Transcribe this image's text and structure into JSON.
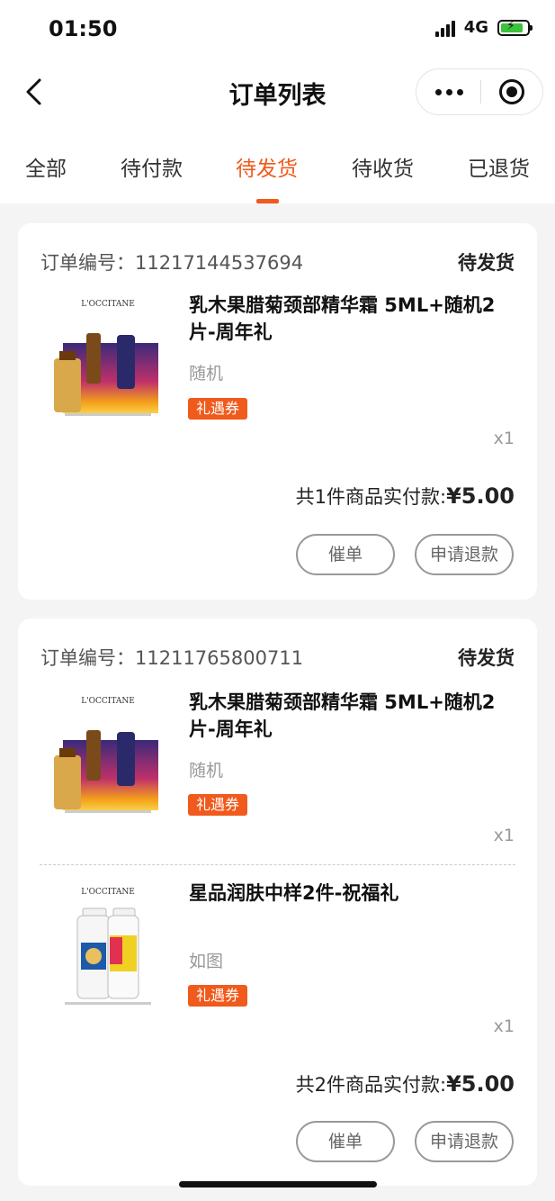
{
  "status_bar": {
    "time": "01:50",
    "network": "4G"
  },
  "nav": {
    "title": "订单列表",
    "more_icon": "more-dots-icon",
    "close_icon": "target-close-icon"
  },
  "tabs": [
    {
      "label": "全部"
    },
    {
      "label": "待付款"
    },
    {
      "label": "待发货",
      "active": true
    },
    {
      "label": "待收货"
    },
    {
      "label": "已退货"
    }
  ],
  "accent_color": "#f05a1c",
  "orders": [
    {
      "order_label": "订单编号：",
      "order_no": "11217144537694",
      "status": "待发货",
      "items": [
        {
          "name": "乳木果腊菊颈部精华霜 5ML+随机2片-周年礼",
          "spec": "随机",
          "tag": "礼遇券",
          "qty": "x1",
          "brand": "L'OCCITANE"
        }
      ],
      "summary": {
        "text": "共1件商品实付款:",
        "amount": "¥5.00"
      },
      "buttons": {
        "urge": "催单",
        "refund": "申请退款"
      }
    },
    {
      "order_label": "订单编号：",
      "order_no": "11211765800711",
      "status": "待发货",
      "items": [
        {
          "name": "乳木果腊菊颈部精华霜 5ML+随机2片-周年礼",
          "spec": "随机",
          "tag": "礼遇券",
          "qty": "x1",
          "brand": "L'OCCITANE"
        },
        {
          "name": "星品润肤中样2件-祝福礼",
          "spec": "如图",
          "tag": "礼遇券",
          "qty": "x1",
          "brand": "L'OCCITANE"
        }
      ],
      "summary": {
        "text": "共2件商品实付款:",
        "amount": "¥5.00"
      },
      "buttons": {
        "urge": "催单",
        "refund": "申请退款"
      }
    }
  ]
}
